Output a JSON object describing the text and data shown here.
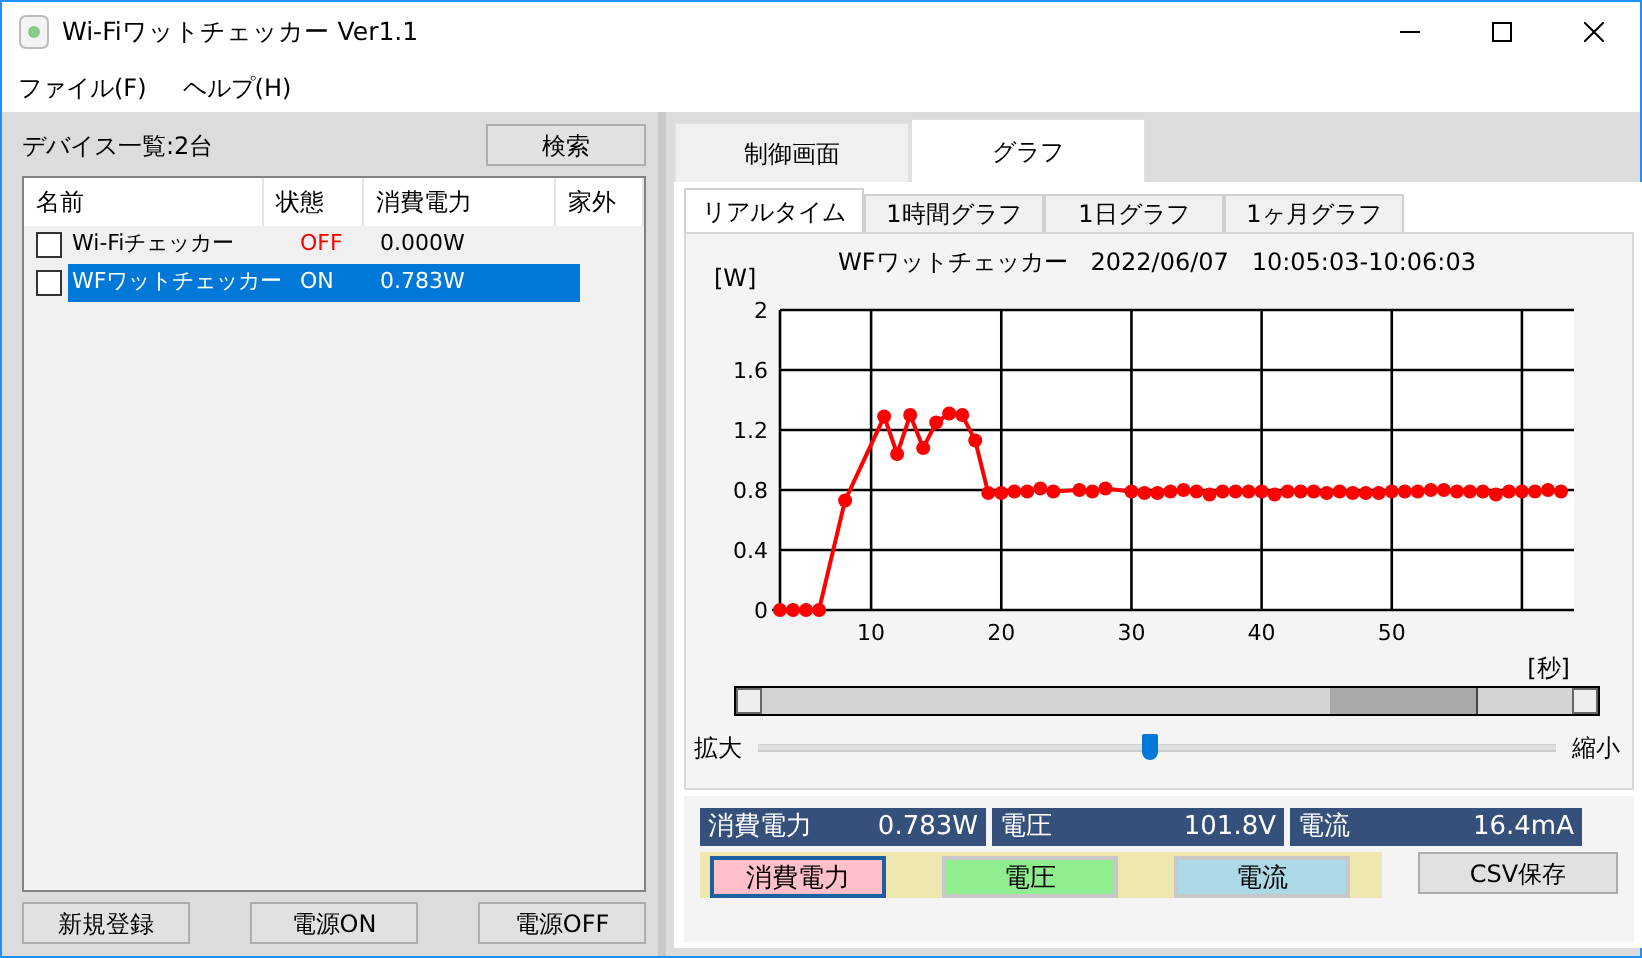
{
  "window": {
    "title": "Wi-Fiワットチェッカー Ver1.1"
  },
  "menu": [
    "ファイル(F)",
    "ヘルプ(H)"
  ],
  "devices": {
    "label": "デバイス一覧:2台",
    "search_button": "検索",
    "columns": [
      "名前",
      "状態",
      "消費電力",
      "家外"
    ],
    "rows": [
      {
        "checked": false,
        "name": "Wi-Fiチェッカー",
        "status": "OFF",
        "on": false,
        "power": "0.000W",
        "selected": false
      },
      {
        "checked": false,
        "name": "WFワットチェッカー",
        "status": "ON",
        "on": true,
        "power": "0.783W",
        "selected": true
      }
    ],
    "buttons": [
      "新規登録",
      "電源ON",
      "電源OFF"
    ]
  },
  "tabs": [
    {
      "label": "制御画面",
      "selected": false
    },
    {
      "label": "グラフ",
      "selected": true
    }
  ],
  "graph_tabs": [
    {
      "label": "リアルタイム",
      "selected": true
    },
    {
      "label": "1時間グラフ",
      "selected": false
    },
    {
      "label": "1日グラフ",
      "selected": false
    },
    {
      "label": "1ヶ月グラフ",
      "selected": false
    }
  ],
  "chart_data": {
    "type": "line",
    "title": "WFワットチェッカー   2022/06/07   10:05:03-10:06:03",
    "ylabel": "[W]",
    "xlabel": "[秒]",
    "x": [
      3,
      4,
      5,
      6,
      8,
      11,
      12,
      13,
      14,
      15,
      16,
      17,
      18,
      19,
      20,
      21,
      22,
      23,
      24,
      26,
      27,
      28,
      30,
      31,
      32,
      33,
      34,
      35,
      36,
      37,
      38,
      39,
      40,
      41,
      42,
      43,
      44,
      45,
      46,
      47,
      48,
      49,
      50,
      51,
      52,
      53,
      54,
      55,
      56,
      57,
      58,
      59,
      60,
      61,
      62,
      63
    ],
    "series": [
      {
        "color": "#ff0000",
        "marker": true,
        "values": [
          0,
          0,
          0,
          0,
          0.73,
          1.29,
          1.04,
          1.3,
          1.08,
          1.25,
          1.31,
          1.3,
          1.13,
          0.78,
          0.78,
          0.79,
          0.79,
          0.81,
          0.79,
          0.8,
          0.79,
          0.81,
          0.79,
          0.78,
          0.78,
          0.79,
          0.8,
          0.79,
          0.77,
          0.79,
          0.79,
          0.79,
          0.79,
          0.77,
          0.79,
          0.79,
          0.79,
          0.78,
          0.79,
          0.78,
          0.78,
          0.78,
          0.79,
          0.79,
          0.79,
          0.8,
          0.8,
          0.79,
          0.79,
          0.79,
          0.77,
          0.79,
          0.79,
          0.79,
          0.8,
          0.79
        ]
      }
    ],
    "grid": true,
    "xlim": [
      3,
      64
    ],
    "ylim": [
      0,
      2
    ],
    "xticks": [
      10,
      20,
      30,
      40,
      50
    ],
    "yticks": [
      0,
      0.4,
      0.8,
      1.2,
      1.6,
      2
    ]
  },
  "zoom": {
    "min_label": "拡大",
    "max_label": "縮小",
    "level": 0.49
  },
  "readouts": [
    {
      "label": "消費電力",
      "value": "0.783W"
    },
    {
      "label": "電圧",
      "value": "101.8V"
    },
    {
      "label": "電流",
      "value": "16.4mA"
    }
  ],
  "series_buttons": [
    {
      "label": "消費電力",
      "color": "#ffc0cb",
      "selected": true
    },
    {
      "label": "電圧",
      "color": "#90ee90",
      "selected": false
    },
    {
      "label": "電流",
      "color": "#add8e6",
      "selected": false
    }
  ],
  "csv_button": "CSV保存"
}
